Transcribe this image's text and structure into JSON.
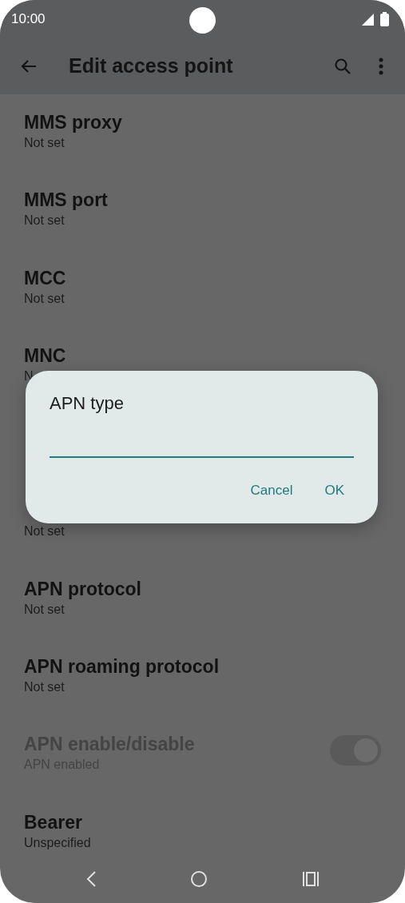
{
  "status_bar": {
    "time": "10:00"
  },
  "app_bar": {
    "title": "Edit access point"
  },
  "settings": [
    {
      "kind": "text",
      "title": "MMS proxy",
      "subtitle": "Not set"
    },
    {
      "kind": "text",
      "title": "MMS port",
      "subtitle": "Not set"
    },
    {
      "kind": "text",
      "title": "MCC",
      "subtitle": "Not set"
    },
    {
      "kind": "text",
      "title": "MNC",
      "subtitle": "N"
    },
    {
      "kind": "covered"
    },
    {
      "kind": "text",
      "subtitle": "Not set"
    },
    {
      "kind": "text",
      "title": "APN protocol",
      "subtitle": "Not set"
    },
    {
      "kind": "text",
      "title": "APN roaming protocol",
      "subtitle": "Not set"
    },
    {
      "kind": "switch",
      "title": "APN enable/disable",
      "subtitle": "APN enabled",
      "disabled": true,
      "on": true
    },
    {
      "kind": "text",
      "title": "Bearer",
      "subtitle": "Unspecified"
    }
  ],
  "dialog": {
    "title": "APN type",
    "buttons": [
      "Cancel",
      "OK"
    ]
  }
}
